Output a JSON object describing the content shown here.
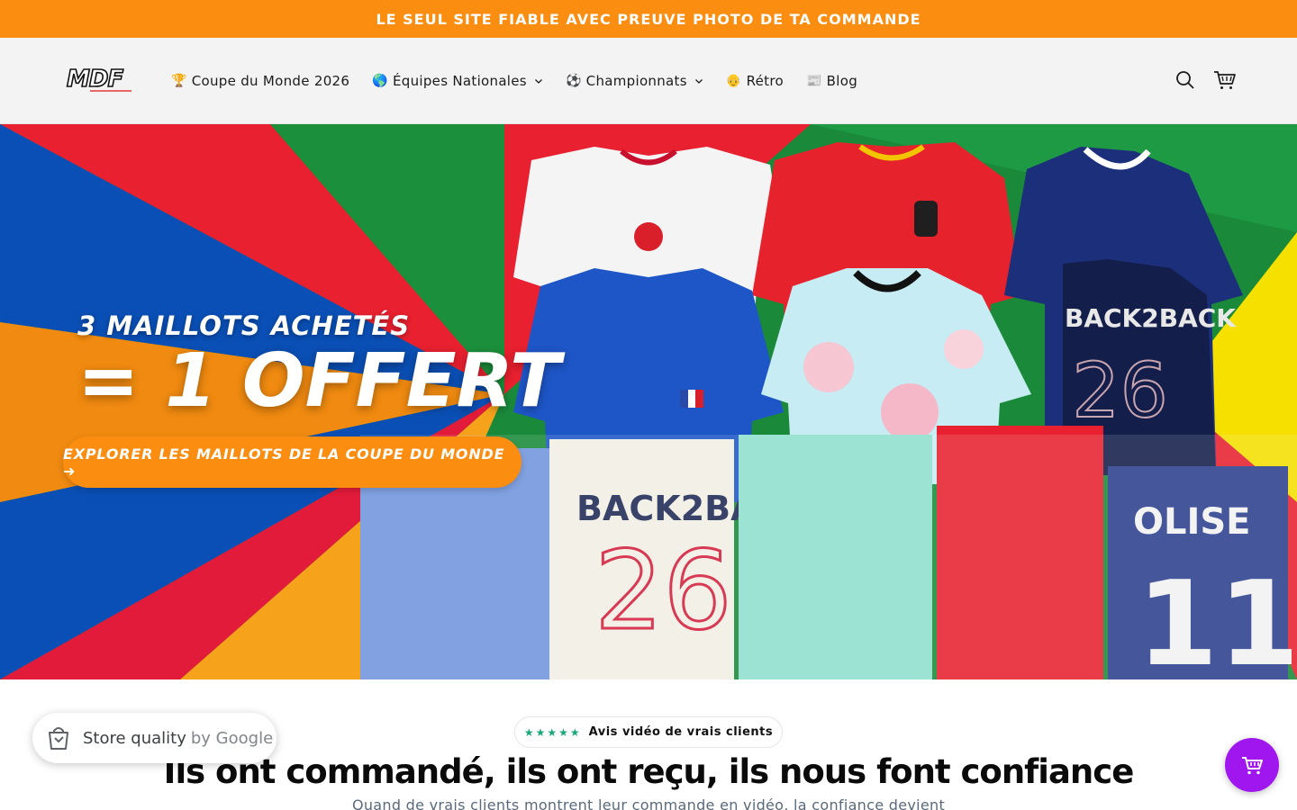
{
  "announcement": {
    "text": "LE SEUL SITE FIABLE AVEC PREUVE PHOTO DE TA COMMANDE"
  },
  "header": {
    "logo_text": "MDF",
    "nav": [
      {
        "emoji": "🏆",
        "label": "Coupe du Monde 2026",
        "has_dropdown": false
      },
      {
        "emoji": "🌎",
        "label": "Équipes Nationales",
        "has_dropdown": true
      },
      {
        "emoji": "⚽",
        "label": "Championnats",
        "has_dropdown": true
      },
      {
        "emoji": "👴",
        "label": "Rétro",
        "has_dropdown": false
      },
      {
        "emoji": "📰",
        "label": "Blog",
        "has_dropdown": false
      }
    ],
    "icons": [
      "search-icon",
      "cart-icon"
    ]
  },
  "hero": {
    "subtitle": "3 MAILLOTS ACHETÉS",
    "title": "= 1 OFFERT",
    "cta_label": "EXPLORER LES MAILLOTS DE LA COUPE DU MONDE ➜",
    "accent_color": "#fb8d10"
  },
  "google_badge": {
    "label": "Store quality",
    "suffix": "by Google"
  },
  "reviews": {
    "stars": "★★★★★",
    "pill_text": "Avis vidéo de vrais clients",
    "title": "Ils ont commandé, ils ont reçu, ils nous font confiance",
    "subtitle": "Quand de vrais clients montrent leur commande en vidéo, la confiance devient"
  },
  "colors": {
    "orange": "#fb8d10",
    "header_bg": "#f3f3f3",
    "fab": "#a016ef",
    "stars": "#19a974"
  }
}
